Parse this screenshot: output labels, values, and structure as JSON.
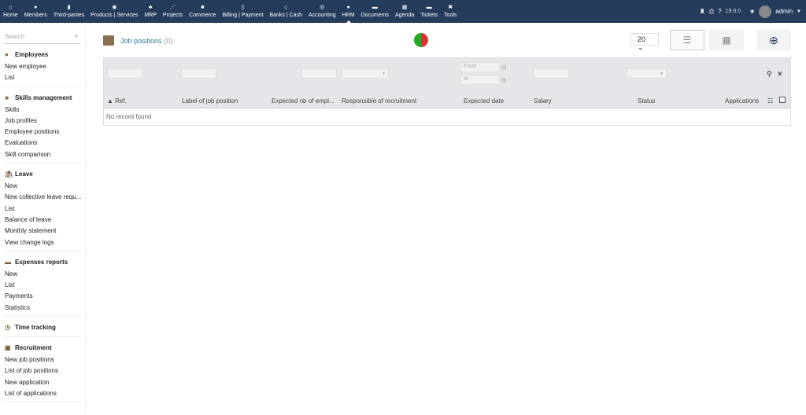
{
  "nav": [
    {
      "label": "Home",
      "icon": "home-icon",
      "g": "⌂"
    },
    {
      "label": "Members",
      "icon": "user-icon",
      "g": "●"
    },
    {
      "label": "Third-parties",
      "icon": "building-icon",
      "g": "▮"
    },
    {
      "label": "Products | Services",
      "icon": "cube-icon",
      "g": "◉"
    },
    {
      "label": "MRP",
      "icon": "cubes-icon",
      "g": "♣"
    },
    {
      "label": "Projects",
      "icon": "project-icon",
      "g": "⋰"
    },
    {
      "label": "Commerce",
      "icon": "suitcase-icon",
      "g": "■"
    },
    {
      "label": "Billing | Payment",
      "icon": "invoice-icon",
      "g": "▯"
    },
    {
      "label": "Banks | Cash",
      "icon": "bank-icon",
      "g": "⌂"
    },
    {
      "label": "Accounting",
      "icon": "search-dollar-icon",
      "g": "◎"
    },
    {
      "label": "HRM",
      "icon": "user-tie-icon",
      "g": "●"
    },
    {
      "label": "Documents",
      "icon": "folder-icon",
      "g": "▬"
    },
    {
      "label": "Agenda",
      "icon": "calendar-icon",
      "g": "▦"
    },
    {
      "label": "Tickets",
      "icon": "ticket-icon",
      "g": "▬"
    },
    {
      "label": "Tools",
      "icon": "tools-icon",
      "g": "✖"
    }
  ],
  "topright": {
    "version": "19.0.0",
    "user": "admin"
  },
  "sidebar": {
    "search_placeholder": "Search",
    "sections": [
      {
        "title": "Employees",
        "items": [
          "New employee",
          "List"
        ]
      },
      {
        "title": "Skills management",
        "items": [
          "Skills",
          "Job profiles",
          "Employee positions",
          "Evaluations",
          "Skill comparison"
        ]
      },
      {
        "title": "Leave",
        "items": [
          "New",
          "New collective leave requ...",
          "List",
          "Balance of leave",
          "Monthly statement",
          "View change logs"
        ]
      },
      {
        "title": "Expenses reports",
        "items": [
          "New",
          "List",
          "Payments",
          "Statistics"
        ]
      },
      {
        "title": "Time tracking",
        "items": []
      },
      {
        "title": "Recruitment",
        "items": [
          "New job positions",
          "List of job positions",
          "New application",
          "List of applications"
        ]
      }
    ]
  },
  "page": {
    "title": "Job positions",
    "count": "(0)",
    "per_page": "20"
  },
  "filters": {
    "from": "From",
    "to": "to"
  },
  "columns": [
    "Ref.",
    "Label of job position",
    "Expected nb of empl...",
    "Responsible of recruitment",
    "Expected date",
    "Salary",
    "Status",
    "Applications"
  ],
  "empty": "No record found"
}
